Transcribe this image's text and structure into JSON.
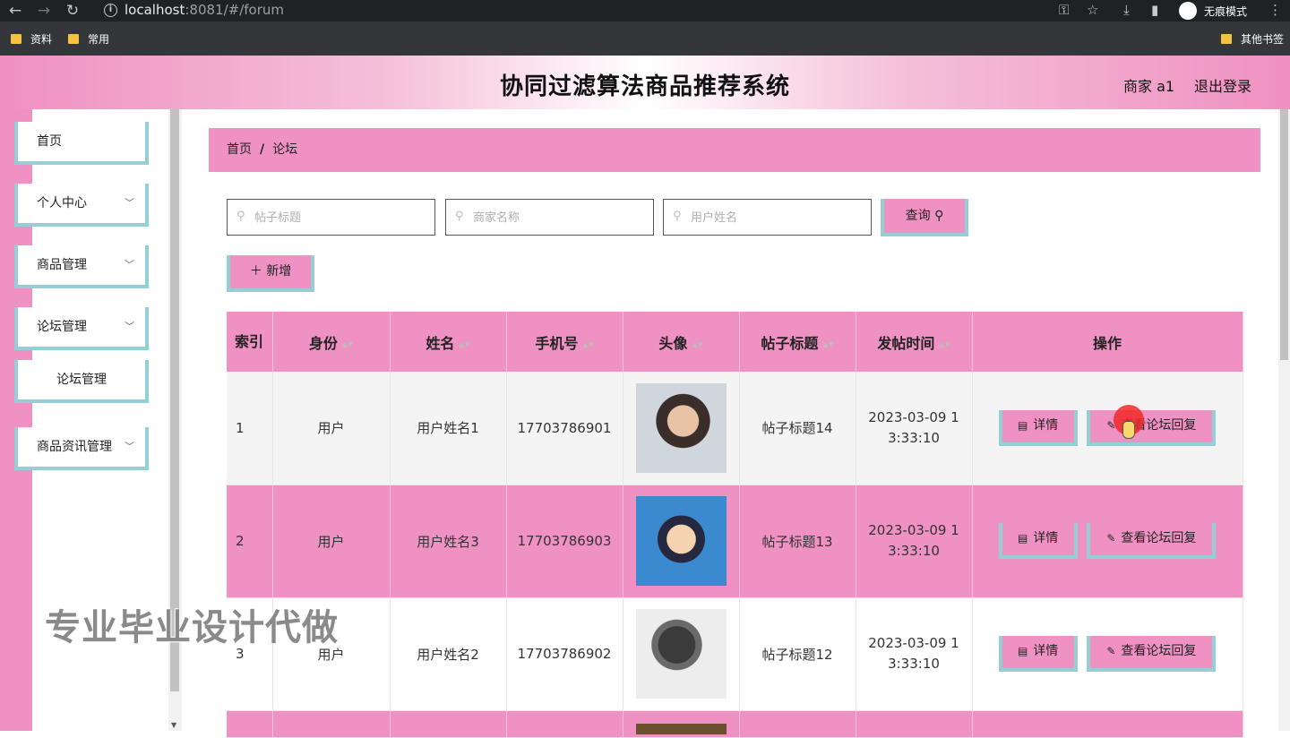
{
  "browser": {
    "url_host": "localhost",
    "url_rest": ":8081/#/forum",
    "incognito_label": "无痕模式",
    "bookmarks": [
      "资料",
      "常用"
    ],
    "other_bookmarks": "其他书签"
  },
  "header": {
    "title": "协同过滤算法商品推荐系统",
    "user": "商家 a1",
    "logout": "退出登录"
  },
  "sidebar": {
    "items": [
      {
        "label": "首页",
        "chevron": false
      },
      {
        "label": "个人中心",
        "chevron": true
      },
      {
        "label": "商品管理",
        "chevron": true
      },
      {
        "label": "论坛管理",
        "chevron": true
      },
      {
        "label": "论坛管理",
        "chevron": false
      },
      {
        "label": "商品资讯管理",
        "chevron": true
      }
    ]
  },
  "breadcrumb": {
    "home": "首页",
    "current": "论坛"
  },
  "search": {
    "title_placeholder": "帖子标题",
    "merchant_placeholder": "商家名称",
    "user_placeholder": "用户姓名",
    "query_label": "查询"
  },
  "add_label": "新增",
  "table": {
    "headers": [
      "索引",
      "身份",
      "姓名",
      "手机号",
      "头像",
      "帖子标题",
      "发帖时间",
      "操作"
    ],
    "rows": [
      {
        "index": "1",
        "role": "用户",
        "name": "用户姓名1",
        "phone": "17703786901",
        "avatar": "avatar-young-man",
        "title": "帖子标题14",
        "time_a": "2023-03-09 1",
        "time_b": "3:33:10"
      },
      {
        "index": "2",
        "role": "用户",
        "name": "用户姓名3",
        "phone": "17703786903",
        "avatar": "avatar-cartoon-boy",
        "title": "帖子标题13",
        "time_a": "2023-03-09 1",
        "time_b": "3:33:10"
      },
      {
        "index": "3",
        "role": "用户",
        "name": "用户姓名2",
        "phone": "17703786902",
        "avatar": "avatar-silhouette",
        "title": "帖子标题12",
        "time_a": "2023-03-09 1",
        "time_b": "3:33:10"
      }
    ],
    "detail_label": "详情",
    "reply_label": "查看论坛回复"
  },
  "watermark": "专业毕业设计代做",
  "colors": {
    "accent_pink": "#ef91c2",
    "accent_teal": "#94cfd6"
  }
}
